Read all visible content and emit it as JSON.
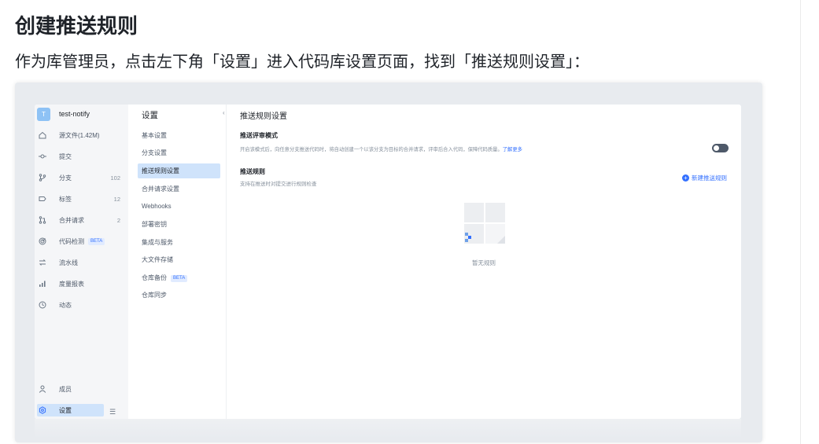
{
  "doc": {
    "title": "创建推送规则",
    "intro": "作为库管理员，点击左下角「设置」进入代码库设置页面，找到「推送规则设置」："
  },
  "repo": {
    "avatar_letter": "T",
    "name": "test-notify"
  },
  "nav": {
    "items": [
      {
        "label": "源文件(1.42M)",
        "icon": "home-icon"
      },
      {
        "label": "提交",
        "icon": "commit-icon"
      },
      {
        "label": "分支",
        "count": "102",
        "icon": "branch-icon"
      },
      {
        "label": "标签",
        "count": "12",
        "icon": "tag-icon"
      },
      {
        "label": "合并请求",
        "count": "2",
        "icon": "merge-request-icon"
      },
      {
        "label": "代码检测",
        "badge": "BETA",
        "icon": "code-scan-icon"
      },
      {
        "label": "流水线",
        "icon": "pipeline-icon"
      },
      {
        "label": "度量报表",
        "icon": "chart-icon"
      },
      {
        "label": "动态",
        "icon": "history-icon"
      }
    ],
    "members": "成员",
    "settings": "设置"
  },
  "settings_menu": {
    "title": "设置",
    "items": [
      {
        "label": "基本设置"
      },
      {
        "label": "分支设置"
      },
      {
        "label": "推送规则设置",
        "active": true
      },
      {
        "label": "合并请求设置"
      },
      {
        "label": "Webhooks"
      },
      {
        "label": "部署密钥"
      },
      {
        "label": "集成与服务"
      },
      {
        "label": "大文件存储"
      },
      {
        "label": "仓库备份",
        "badge": "BETA"
      },
      {
        "label": "仓库同步"
      }
    ]
  },
  "main": {
    "title": "推送规则设置",
    "review_mode": {
      "heading": "推送评审模式",
      "desc": "开启该模式后，向任意分支推送代码时，将自动创建一个以该分支为目标的合并请求，评审后合入代码，保障代码质量。",
      "link": "了解更多",
      "enabled": false
    },
    "push_rules": {
      "heading": "推送规则",
      "desc": "支持在推送时对提交进行规则检查",
      "new_button": "新建推送规则",
      "empty": "暂无规则"
    }
  },
  "colors": {
    "accent": "#3370ff",
    "active_bg": "#cfe3fb",
    "nav_bg": "#f5f6f8"
  }
}
